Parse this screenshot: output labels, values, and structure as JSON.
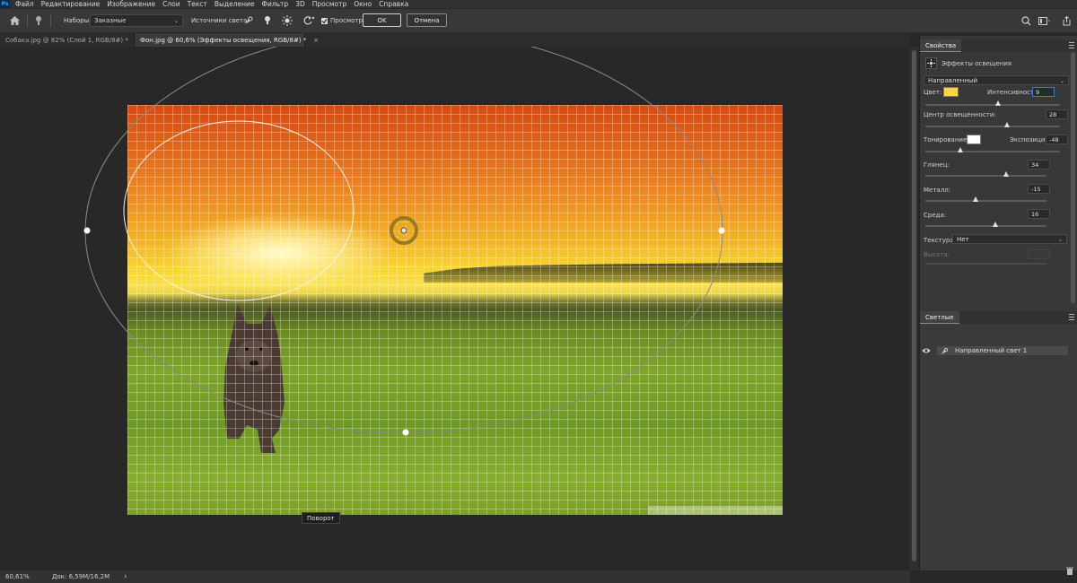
{
  "menu": {
    "logo": "Ps",
    "items": [
      "Файл",
      "Редактирование",
      "Изображение",
      "Слои",
      "Текст",
      "Выделение",
      "Фильтр",
      "3D",
      "Просмотр",
      "Окно",
      "Справка"
    ]
  },
  "options": {
    "presets_label": "Наборы:",
    "presets_value": "Заказные",
    "light_sources_label": "Источники света:",
    "preview_label": "Просмотр",
    "preview_checked": true,
    "ok_label": "OK",
    "cancel_label": "Отмена"
  },
  "tabs": [
    {
      "label": "Собака.jpg @ 82% (Слой 1, RGB/8#) *",
      "close": "×"
    },
    {
      "label": "Фон.jpg @ 60,6% (Эффекты освещения, RGB/8#) *",
      "close": "×"
    }
  ],
  "canvas": {
    "tooltip": "Поворот"
  },
  "status": {
    "zoom": "60,61%",
    "doc": "Док: 6,59M/16,2M",
    "arrow": "›"
  },
  "properties": {
    "tab_label": "Свойства",
    "effect_title": "Эффекты освещения",
    "light_type": "Направленный",
    "color_label": "Цвет:",
    "color_value": "#ffd34a",
    "intensity_label": "Интенсивность:",
    "intensity_value": "9",
    "hotspot_label": "Центр освещенности:",
    "hotspot_value": "28",
    "colorize_label": "Тонирование:",
    "colorize_value": "#ffffff",
    "exposure_label": "Экспозиция:",
    "exposure_value": "-48",
    "gloss_label": "Глянец:",
    "gloss_value": "34",
    "metallic_label": "Металл:",
    "metallic_value": "-15",
    "ambience_label": "Среда:",
    "ambience_value": "16",
    "texture_label": "Текстура:",
    "texture_value": "Нет",
    "height_label": "Высота:"
  },
  "lights": {
    "tab_label": "Светлые",
    "items": [
      "Направленный свет 1"
    ]
  }
}
